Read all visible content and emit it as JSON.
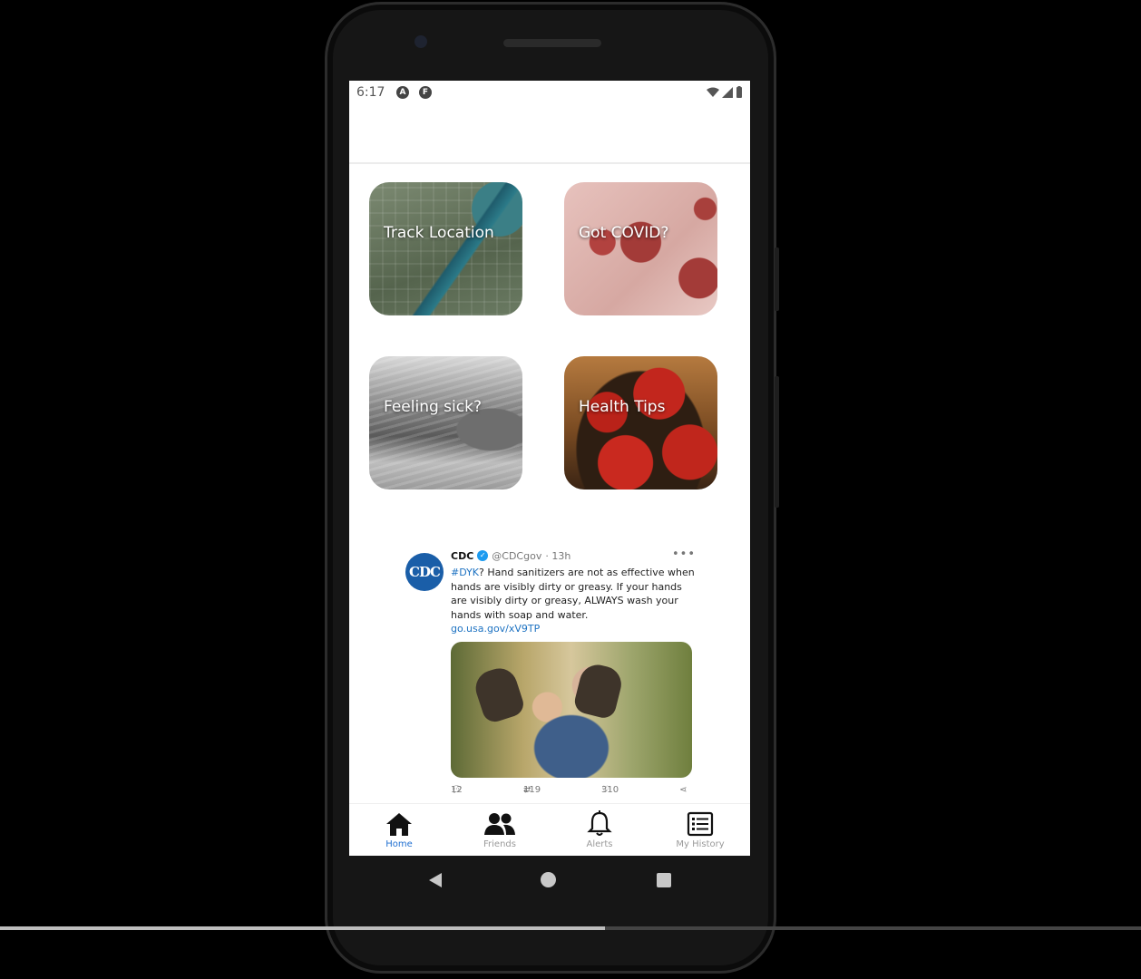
{
  "status_bar": {
    "time": "6:17",
    "icons": [
      "a-badge-icon",
      "f-badge-icon",
      "wifi-icon",
      "signal-icon",
      "battery-icon"
    ]
  },
  "tiles": [
    {
      "label": "Track Location",
      "icon": "map-image"
    },
    {
      "label": "Got COVID?",
      "icon": "virus-image"
    },
    {
      "label": "Feeling sick?",
      "icon": "cat-image"
    },
    {
      "label": "Health Tips",
      "icon": "apples-image"
    }
  ],
  "tweet": {
    "avatar_text": "CDC",
    "name": "CDC",
    "handle": "@CDCgov",
    "time": "· 13h",
    "more": "•••",
    "hashtag": "#DYK",
    "text": "? Hand sanitizers are not as effective when hands are visibly dirty or greasy. If your hands are visibly dirty or greasy, ALWAYS wash your hands with soap and water.",
    "link": "go.usa.gov/xV9TP",
    "replies": "12",
    "retweets": "119",
    "likes": "310"
  },
  "nav": {
    "items": [
      {
        "label": "Home",
        "icon": "home-icon",
        "active": true
      },
      {
        "label": "Friends",
        "icon": "friends-icon",
        "active": false
      },
      {
        "label": "Alerts",
        "icon": "bell-icon",
        "active": false
      },
      {
        "label": "My History",
        "icon": "list-icon",
        "active": false
      }
    ]
  },
  "colors": {
    "accent": "#1f6fd1",
    "tweet_link": "#1d72c2",
    "cdc_blue": "#1a5ea8"
  },
  "video_progress": 0.53
}
